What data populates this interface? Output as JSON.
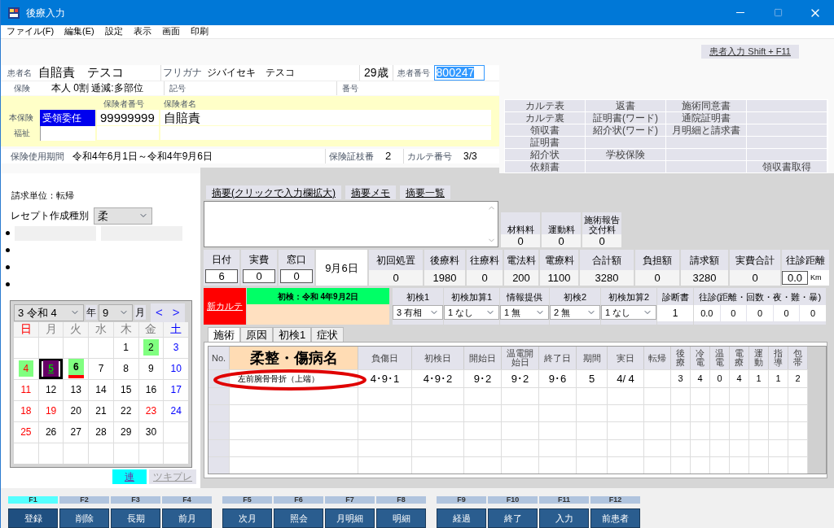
{
  "window": {
    "title": "後療入力"
  },
  "menu": [
    "ファイル(F)",
    "編集(E)",
    "設定",
    "表示",
    "画面",
    "印刷"
  ],
  "patient_input_button": "患者入力 Shift + F11",
  "patient": {
    "name_label": "患者名",
    "name": "自賠責　テスコ",
    "kana_label": "フリガナ",
    "kana": "ジバイセキ　テスコ",
    "age": "29歳",
    "number_label": "患者番号",
    "number": "800247",
    "insurance_label": "保険",
    "insurance": "本人 0割 逓減:多部位",
    "symbol_label": "記号",
    "number2_label": "番号"
  },
  "insurer": {
    "main_label": "本保険",
    "welfare_label": "福祉",
    "type": "受領委任",
    "number_label": "保険者番号",
    "number": "99999999",
    "name_label": "保険者名",
    "name": "自賠責"
  },
  "period": {
    "label": "保険使用期間",
    "value": "令和4年6月1日～令和4年9月6日",
    "branch_label": "保険証枝番",
    "branch": "2",
    "chart_label": "カルテ番号",
    "chart": "3/3"
  },
  "documents": [
    {
      "col_1": "カルテ表",
      "col_2": "返書",
      "col_3": "施術同意書"
    },
    {
      "col_1": "カルテ裏",
      "col_2": "証明書(ワード)",
      "col_3": "通院証明書"
    },
    {
      "col_1": "領収書",
      "col_2": "紹介状(ワード)",
      "col_3": "月明細と請求書"
    },
    {
      "col_1": "証明書"
    },
    {
      "col_1": "紹介状",
      "col_2": "学校保険"
    },
    {
      "col_1": "依頼書",
      "col_4": "領収書取得"
    }
  ],
  "billing_unit": "請求単位：転帰",
  "receipt_type": {
    "label": "レセプト作成種別",
    "value": "柔"
  },
  "calendar": {
    "era": "3 令和 4",
    "year_label": "年",
    "month": "9",
    "month_label": "月",
    "prev": "<",
    "next": ">",
    "weekdays": [
      {
        "text": "日",
        "color": "#ff0000"
      },
      {
        "text": "月",
        "color": "#808080"
      },
      {
        "text": "火",
        "color": "#808080"
      },
      {
        "text": "水",
        "color": "#808080"
      },
      {
        "text": "木",
        "color": "#808080"
      },
      {
        "text": "金",
        "color": "#808080"
      },
      {
        "text": "土",
        "color": "#0000ff"
      }
    ],
    "weeks": [
      [
        {
          "kind": "blank"
        },
        {
          "kind": "blank"
        },
        {
          "kind": "blank"
        },
        {
          "kind": "blank"
        },
        {
          "kind": "weekday",
          "text": "1",
          "visit": false,
          "selected": false,
          "today": false
        },
        {
          "kind": "weekday",
          "text": "2",
          "visit": true,
          "selected": false,
          "today": false
        },
        {
          "kind": "saturday",
          "text": "3",
          "visit": false,
          "selected": false,
          "today": false
        }
      ],
      [
        {
          "kind": "holiday",
          "text": "4",
          "visit": true,
          "selected": false,
          "today": false
        },
        {
          "kind": "weekday",
          "text": "5",
          "visit": false,
          "selected": true,
          "today": false
        },
        {
          "kind": "weekday",
          "text": "6",
          "visit": true,
          "selected": false,
          "today": true
        },
        {
          "kind": "weekday",
          "text": "7",
          "visit": false,
          "selected": false,
          "today": false
        },
        {
          "kind": "weekday",
          "text": "8",
          "visit": false,
          "selected": false,
          "today": false
        },
        {
          "kind": "weekday",
          "text": "9",
          "visit": false,
          "selected": false,
          "today": false
        },
        {
          "kind": "saturday",
          "text": "10",
          "visit": false,
          "selected": false,
          "today": false
        }
      ],
      [
        {
          "kind": "holiday",
          "text": "11",
          "visit": false,
          "selected": false,
          "today": false
        },
        {
          "kind": "weekday",
          "text": "12",
          "visit": false,
          "selected": false,
          "today": false
        },
        {
          "kind": "weekday",
          "text": "13",
          "visit": false,
          "selected": false,
          "today": false
        },
        {
          "kind": "weekday",
          "text": "14",
          "visit": false,
          "selected": false,
          "today": false
        },
        {
          "kind": "weekday",
          "text": "15",
          "visit": false,
          "selected": false,
          "today": false
        },
        {
          "kind": "weekday",
          "text": "16",
          "visit": false,
          "selected": false,
          "today": false
        },
        {
          "kind": "saturday",
          "text": "17",
          "visit": false,
          "selected": false,
          "today": false
        }
      ],
      [
        {
          "kind": "holiday",
          "text": "18",
          "visit": false,
          "selected": false,
          "today": false
        },
        {
          "kind": "holiday",
          "text": "19",
          "visit": false,
          "selected": false,
          "today": false
        },
        {
          "kind": "weekday",
          "text": "20",
          "visit": false,
          "selected": false,
          "today": false
        },
        {
          "kind": "weekday",
          "text": "21",
          "visit": false,
          "selected": false,
          "today": false
        },
        {
          "kind": "weekday",
          "text": "22",
          "visit": false,
          "selected": false,
          "today": false
        },
        {
          "kind": "holiday",
          "text": "23",
          "visit": false,
          "selected": false,
          "today": false
        },
        {
          "kind": "saturday",
          "text": "24",
          "visit": false,
          "selected": false,
          "today": false
        }
      ],
      [
        {
          "kind": "holiday",
          "text": "25",
          "visit": false,
          "selected": false,
          "today": false
        },
        {
          "kind": "weekday",
          "text": "26",
          "visit": false,
          "selected": false,
          "today": false
        },
        {
          "kind": "weekday",
          "text": "27",
          "visit": false,
          "selected": false,
          "today": false
        },
        {
          "kind": "weekday",
          "text": "28",
          "visit": false,
          "selected": false,
          "today": false
        },
        {
          "kind": "weekday",
          "text": "29",
          "visit": false,
          "selected": false,
          "today": false
        },
        {
          "kind": "weekday",
          "text": "30",
          "visit": false,
          "selected": false,
          "today": false
        },
        {
          "kind": "blank"
        }
      ],
      [
        {
          "kind": "blank"
        },
        {
          "kind": "blank"
        },
        {
          "kind": "blank"
        },
        {
          "kind": "blank"
        },
        {
          "kind": "blank"
        },
        {
          "kind": "blank"
        },
        {
          "kind": "blank"
        }
      ]
    ]
  },
  "calendar_buttons": [
    {
      "label": "連",
      "disabled": false
    },
    {
      "label": "ツキプレ",
      "disabled": true
    }
  ],
  "memo_tabs": [
    "摘要(クリックで入力欄拡大)",
    "摘要メモ",
    "摘要一覧"
  ],
  "extra_fees": [
    {
      "label": "材料料",
      "value": "0"
    },
    {
      "label": "運動料",
      "value": "0"
    },
    {
      "label": "施術報告交付料",
      "value": "0"
    }
  ],
  "visit_fields": [
    {
      "label": "日付",
      "value": "6"
    },
    {
      "label": "実費",
      "value": "0"
    },
    {
      "label": "窓口",
      "value": "0"
    }
  ],
  "visit_date": "9月6日",
  "fees": [
    {
      "label": "初回処置",
      "value": "0"
    },
    {
      "label": "後療料",
      "value": "1980"
    },
    {
      "label": "往療料",
      "value": "0"
    },
    {
      "label": "電法料",
      "value": "200"
    },
    {
      "label": "電療料",
      "value": "1100"
    },
    {
      "label": "合計額",
      "value": "3280"
    },
    {
      "label": "負担額",
      "value": "0"
    },
    {
      "label": "請求額",
      "value": "3280"
    },
    {
      "label": "実費合計",
      "value": "0"
    }
  ],
  "distance": {
    "label": "往診距離",
    "value": "0.0",
    "unit": "Km"
  },
  "new_chart_button": "新カルテ",
  "first_visit": "初検：令和 4年9月2日",
  "first_visit_selects": [
    {
      "label": "初検1",
      "value": "3 有相"
    },
    {
      "label": "初検加算1",
      "value": "1 なし"
    },
    {
      "label": "情報提供",
      "value": "1 無"
    },
    {
      "label": "初検2",
      "value": "2 無"
    },
    {
      "label": "初検加算2",
      "value": "1 なし"
    }
  ],
  "certificate": {
    "label": "診断書",
    "value": "1"
  },
  "home_visit": {
    "label": "往診(距離・回数・夜・難・暴)",
    "values": [
      "0.0",
      "0",
      "0",
      "0",
      "0"
    ]
  },
  "tabs": [
    {
      "label": "施術",
      "selected": true
    },
    {
      "label": "原因",
      "selected": false
    },
    {
      "label": "初検1",
      "selected": false
    },
    {
      "label": "症状",
      "selected": false
    }
  ],
  "table": {
    "columns": [
      "No.",
      "柔整・傷病名",
      "負傷日",
      "初検日",
      "開始日",
      "温電開始日",
      "終了日",
      "期間",
      "実日",
      "転帰",
      "後療",
      "冷電",
      "温電",
      "電療",
      "運動",
      "指導",
      "包帯"
    ],
    "rows": [
      {
        "injury_name": "左前腕骨骨折（上端）",
        "injury_date": "4･9･1",
        "first_visit_date": "4･9･2",
        "start_date": "9･2",
        "electro_start_date": "9･2",
        "end_date": "9･6",
        "period": "5",
        "actual_days": "4/ 4",
        "after_care": "3",
        "cold_electro": "4",
        "warm_electro": "0",
        "electro": "4",
        "exercise": "1",
        "guidance": "1",
        "bandage": "2"
      }
    ]
  },
  "function_keys": [
    {
      "key": "F1",
      "label": "登録",
      "selected": true
    },
    {
      "key": "F2",
      "label": "削除",
      "selected": false
    },
    {
      "key": "F3",
      "label": "長期",
      "selected": false
    },
    {
      "key": "F4",
      "label": "前月",
      "selected": false
    },
    {
      "key": "F5",
      "label": "次月",
      "selected": false
    },
    {
      "key": "F6",
      "label": "照会",
      "selected": false
    },
    {
      "key": "F7",
      "label": "月明細",
      "selected": false
    },
    {
      "key": "F8",
      "label": "明細",
      "selected": false
    },
    {
      "key": "F9",
      "label": "経過",
      "selected": false
    },
    {
      "key": "F10",
      "label": "終了",
      "selected": false
    },
    {
      "key": "F11",
      "label": "入力",
      "selected": false
    },
    {
      "key": "F12",
      "label": "前患者",
      "selected": false
    }
  ]
}
